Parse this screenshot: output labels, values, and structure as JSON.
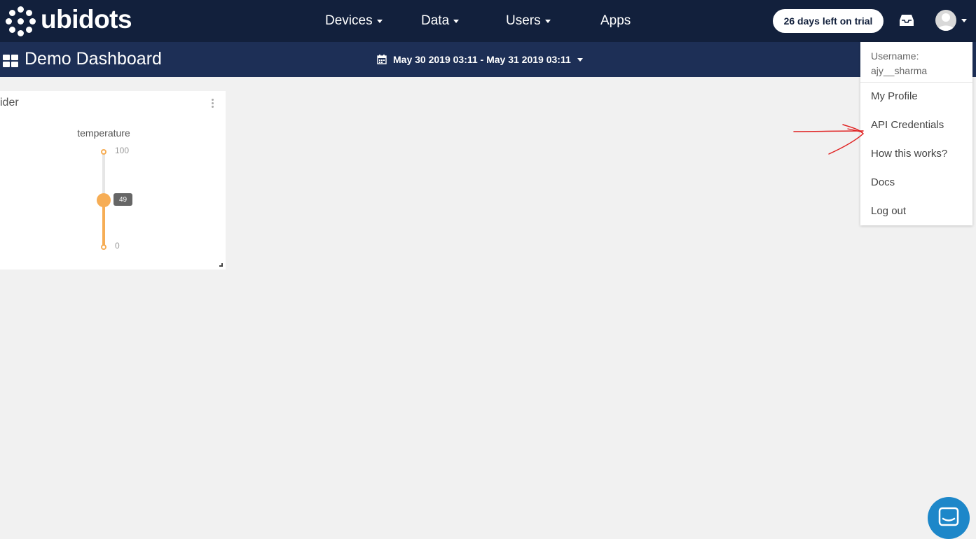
{
  "brand": {
    "name": "ubidots"
  },
  "nav": {
    "items": [
      {
        "label": "Devices"
      },
      {
        "label": "Data"
      },
      {
        "label": "Users"
      },
      {
        "label": "Apps"
      }
    ]
  },
  "trial": {
    "label": "26 days left on trial"
  },
  "dashboard": {
    "title": "Demo Dashboard",
    "date_range": "May 30 2019 03:11 - May 31 2019 03:11"
  },
  "widget": {
    "title": "ider",
    "variable": "temperature",
    "max_label": "100",
    "min_label": "0",
    "value": "49",
    "value_fraction": 0.49
  },
  "user_menu": {
    "username_label": "Username:",
    "username": "ajy__sharma",
    "items": [
      {
        "label": "My Profile"
      },
      {
        "label": "API Credentials"
      },
      {
        "label": "How this works?"
      },
      {
        "label": "Docs"
      },
      {
        "label": "Log out"
      }
    ]
  },
  "colors": {
    "navbar": "#12203c",
    "subbar": "#1d2f56",
    "slider_accent": "#f6ad55",
    "annotation": "#e02020",
    "chat": "#1d87c9"
  }
}
